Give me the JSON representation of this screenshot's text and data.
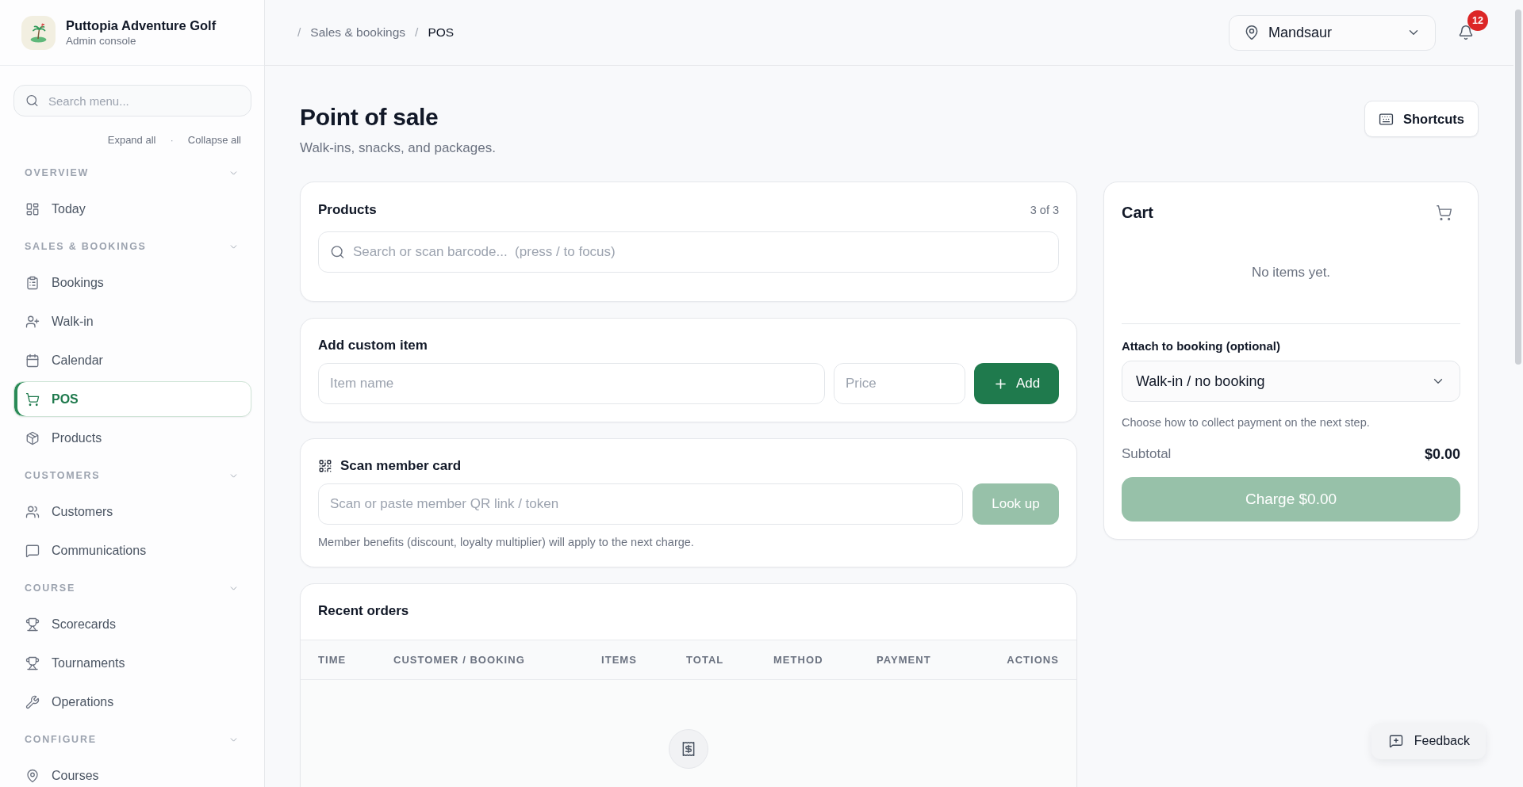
{
  "app": {
    "name": "Puttopia Adventure Golf",
    "subtitle": "Admin console"
  },
  "sidebar": {
    "search": {
      "placeholder": "Search menu..."
    },
    "expand_all": "Expand all",
    "separator": "·",
    "collapse_all": "Collapse all",
    "sections": [
      {
        "title": "OVERVIEW",
        "expanded": true,
        "items": [
          {
            "label": "Today",
            "selected": false
          }
        ]
      },
      {
        "title": "SALES & BOOKINGS",
        "expanded": true,
        "items": [
          {
            "label": "Bookings",
            "selected": false
          },
          {
            "label": "Walk-in",
            "selected": false
          },
          {
            "label": "Calendar",
            "selected": false
          },
          {
            "label": "POS",
            "selected": true
          },
          {
            "label": "Products",
            "selected": false
          }
        ]
      },
      {
        "title": "CUSTOMERS",
        "expanded": true,
        "items": [
          {
            "label": "Customers",
            "selected": false
          },
          {
            "label": "Communications",
            "selected": false
          }
        ]
      },
      {
        "title": "COURSE",
        "expanded": true,
        "items": [
          {
            "label": "Scorecards",
            "selected": false
          },
          {
            "label": "Tournaments",
            "selected": false
          },
          {
            "label": "Operations",
            "selected": false
          }
        ]
      },
      {
        "title": "CONFIGURE",
        "expanded": true,
        "items": [
          {
            "label": "Courses",
            "selected": false
          }
        ]
      }
    ]
  },
  "topbar": {
    "breadcrumb": [
      {
        "separator": "/",
        "label": "Sales & bookings",
        "current": false
      },
      {
        "separator": "/",
        "label": "POS",
        "current": true
      }
    ],
    "location_select": {
      "value": "Mandsaur"
    },
    "notifications": {
      "badge": "12"
    }
  },
  "page": {
    "title": "Point of sale",
    "subtitle": "Walk-ins, snacks, and packages.",
    "shortcuts_button": "Shortcuts"
  },
  "products": {
    "title": "Products",
    "count": "3 of 3",
    "search": {
      "placeholder": "Search or scan barcode...  (press / to focus)"
    }
  },
  "custom_item": {
    "title": "Add custom item",
    "name_field": {
      "placeholder": "Item name"
    },
    "price_field": {
      "placeholder": "Price"
    },
    "add_button": "Add"
  },
  "member_card": {
    "title": "Scan member card",
    "field": {
      "placeholder": "Scan or paste member QR link / token"
    },
    "lookup_button": {
      "label": "Look up",
      "disabled": true
    },
    "note": "Member benefits (discount, loyalty multiplier) will apply to the next charge."
  },
  "recent_orders": {
    "title": "Recent orders",
    "table": {
      "columns": [
        "TIME",
        "CUSTOMER / BOOKING",
        "ITEMS",
        "TOTAL",
        "METHOD",
        "PAYMENT",
        "ACTIONS"
      ]
    }
  },
  "cart": {
    "title": "Cart",
    "empty_text": "No items yet.",
    "booking_label": "Attach to booking (optional)",
    "booking_select": {
      "value": "Walk-in / no booking"
    },
    "hint": "Choose how to collect payment on the next step.",
    "subtotal_label": "Subtotal",
    "subtotal_value": "$0.00",
    "charge_button": {
      "label": "Charge $0.00",
      "disabled": true
    }
  },
  "feedback_button": "Feedback"
}
